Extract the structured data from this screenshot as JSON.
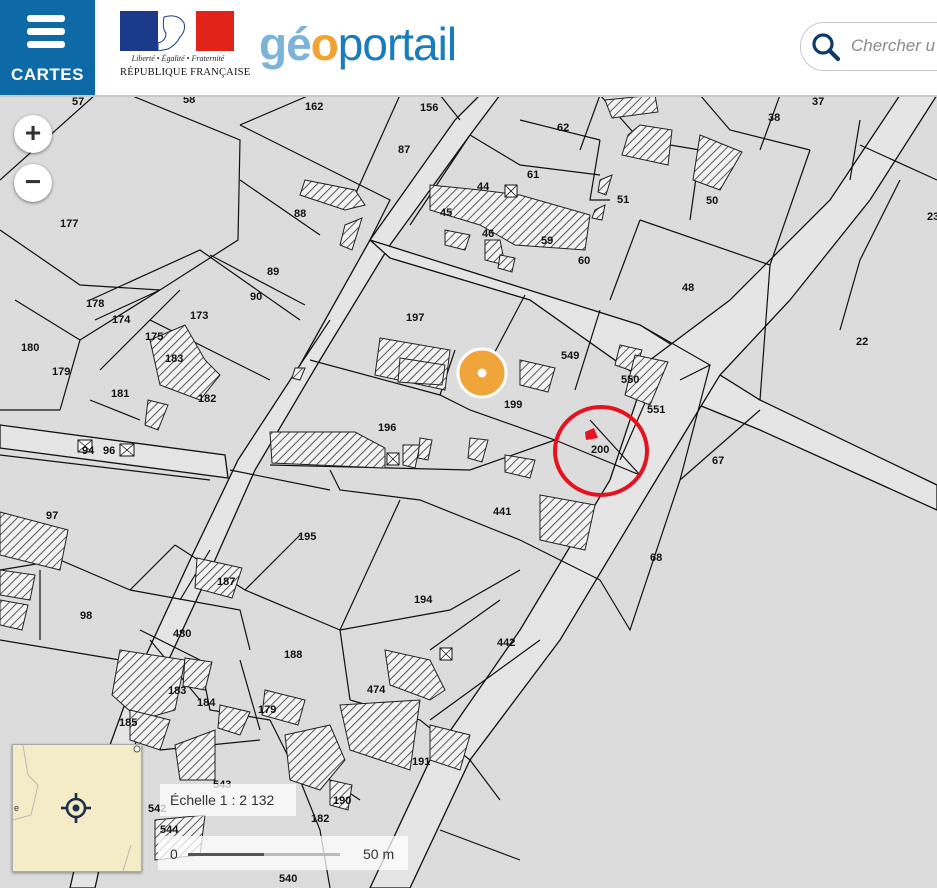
{
  "header": {
    "menu_label": "CARTES",
    "rf_motto": "Liberté • Égalité • Fraternité",
    "rf_name": "RÉPUBLIQUE FRANÇAISE",
    "brand_part1": "gé",
    "brand_part2": "o",
    "brand_part3": "portail",
    "search_placeholder": "Chercher u"
  },
  "colors": {
    "menu_blue": "#0e6aa6",
    "brand_light_blue": "#7cb3d9",
    "brand_orange": "#f2a230",
    "brand_blue": "#1a7cbf",
    "marker_orange": "#f0a53a",
    "highlight_red": "#e5131f"
  },
  "map": {
    "zoom_in": "+",
    "zoom_out": "−",
    "scale_text": "Échelle 1 : 2 132",
    "scalebar_start": "0",
    "scalebar_end": "50 m",
    "parcels": [
      "57",
      "58",
      "162",
      "156",
      "37",
      "62",
      "38",
      "87",
      "177",
      "88",
      "61",
      "44",
      "51",
      "50",
      "45",
      "46",
      "59",
      "60",
      "23",
      "89",
      "90",
      "48",
      "178",
      "174",
      "173",
      "197",
      "175",
      "180",
      "183",
      "549",
      "22",
      "179",
      "181",
      "182",
      "550",
      "199",
      "551",
      "196",
      "200",
      "94",
      "96",
      "67",
      "97",
      "195",
      "441",
      "187",
      "68",
      "98",
      "194",
      "480",
      "442",
      "188",
      "183",
      "474",
      "184",
      "179",
      "185",
      "191",
      "543",
      "542",
      "544",
      "182",
      "190",
      "540"
    ]
  }
}
